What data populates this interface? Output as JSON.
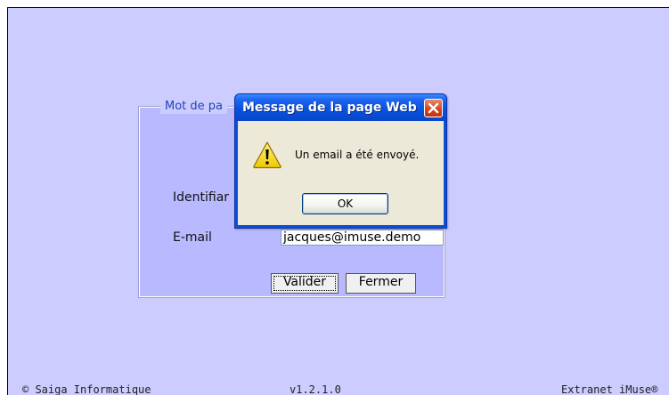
{
  "form": {
    "legend": "Mot de pa",
    "identifiant_label": "Identifiar",
    "identifiant_value": "",
    "email_label": "E-mail",
    "email_value": "jacques@imuse.demo",
    "valider_label": "Valider",
    "fermer_label": "Fermer"
  },
  "footer": {
    "copyright": "© Saiga Informatique",
    "version": "v1.2.1.0",
    "product": "Extranet iMuse®"
  },
  "dialog": {
    "title": "Message de la page Web",
    "message": "Un email a été envoyé.",
    "ok_label": "OK",
    "icon": "warning-icon",
    "close_icon": "close-icon"
  },
  "colors": {
    "page_background": "#ccccff",
    "fieldset_background": "#b9b9ff",
    "legend_text": "#2244bb",
    "dialog_titlebar": "#0a52e0",
    "dialog_body": "#ece9d8",
    "close_button": "#d5421c"
  }
}
